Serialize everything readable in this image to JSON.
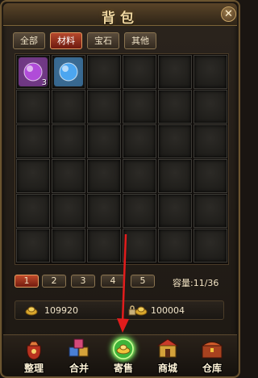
{
  "window": {
    "title": "背包"
  },
  "tabs": [
    {
      "label": "全部",
      "active": false
    },
    {
      "label": "材料",
      "active": true
    },
    {
      "label": "宝石",
      "active": false
    },
    {
      "label": "其他",
      "active": false
    }
  ],
  "grid": {
    "items": [
      {
        "name": "purple-orb-item",
        "count": "3",
        "color": "#b04cd8"
      },
      {
        "name": "blue-crystal-item",
        "count": "",
        "color": "#4ca6f0"
      }
    ]
  },
  "pages": [
    {
      "label": "1",
      "active": true
    },
    {
      "label": "2",
      "active": false
    },
    {
      "label": "3",
      "active": false
    },
    {
      "label": "4",
      "active": false
    },
    {
      "label": "5",
      "active": false
    }
  ],
  "capacity": "容量:11/36",
  "currency": {
    "gold": "109920",
    "bound_gold": "100004"
  },
  "actions": [
    {
      "label": "整理",
      "icon": "sort-bag-icon"
    },
    {
      "label": "合并",
      "icon": "merge-blocks-icon"
    },
    {
      "label": "寄售",
      "icon": "consign-icon",
      "highlight": true
    },
    {
      "label": "商城",
      "icon": "shop-icon"
    },
    {
      "label": "仓库",
      "icon": "warehouse-chest-icon"
    }
  ],
  "colors": {
    "accent_red": "#c04a2a",
    "frame_gold": "#8a7450",
    "highlight_arrow": "#e21c1c"
  }
}
